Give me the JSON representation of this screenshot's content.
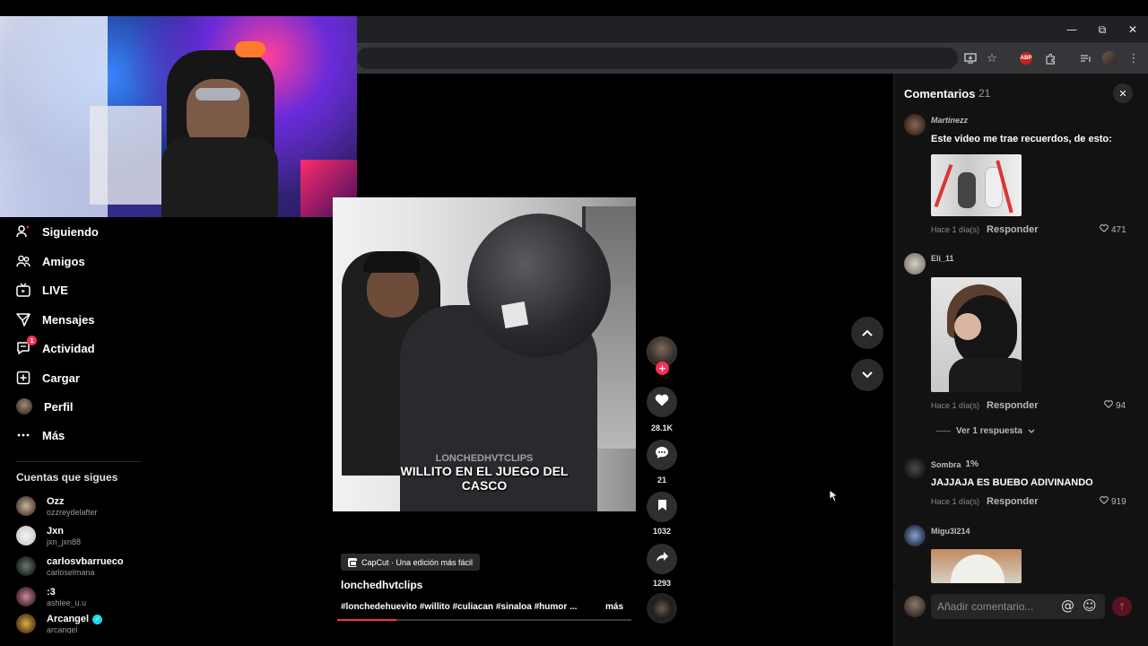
{
  "browser": {
    "window_controls": {
      "minimize": "—",
      "restore": "⧉",
      "close": "✕"
    },
    "toolbar_icons": [
      "install-app-icon",
      "bookmark-star-icon",
      "adblock-extension-icon",
      "extensions-puzzle-icon",
      "media-control-icon",
      "profile-avatar-icon",
      "menu-kebab-icon"
    ],
    "adblock_label": "ABP"
  },
  "sidebar": {
    "nav": [
      {
        "label": "Siguiendo",
        "icon": "following-icon"
      },
      {
        "label": "Amigos",
        "icon": "friends-icon"
      },
      {
        "label": "LIVE",
        "icon": "live-tv-icon"
      },
      {
        "label": "Mensajes",
        "icon": "messages-icon"
      },
      {
        "label": "Actividad",
        "icon": "activity-icon",
        "badge": "1"
      },
      {
        "label": "Cargar",
        "icon": "upload-icon"
      },
      {
        "label": "Perfil",
        "icon": "profile-icon"
      },
      {
        "label": "Más",
        "icon": "more-icon"
      }
    ],
    "following_title": "Cuentas que sigues",
    "accounts": [
      {
        "name": "Ozz",
        "handle": "ozzreydelafter",
        "verified": false
      },
      {
        "name": "Jxn",
        "handle": "jxn_jxn88",
        "verified": false
      },
      {
        "name": "carlosvbarrueco",
        "handle": "carloselmana",
        "verified": false
      },
      {
        "name": ":3",
        "handle": "ashlee_u.u",
        "verified": false
      },
      {
        "name": "Arcangel",
        "handle": "arcangel",
        "verified": true
      }
    ]
  },
  "video": {
    "watermark": "LONCHEDHVTCLIPS",
    "caption": "WILLITO EN EL JUEGO DEL CASCO",
    "capcut_label": "CapCut · Una edición más fácil",
    "author": "lonchedhvtclips",
    "hashtags": "#lonchedehuevito #willito #culiacan #sinaloa #humor ...",
    "more_label": "más",
    "progress": 0.2
  },
  "actions": {
    "likes": "28.1K",
    "comments": "21",
    "saves": "1032",
    "shares": "1293"
  },
  "comments_panel": {
    "title": "Comentarios",
    "count": "21",
    "comments": [
      {
        "user": "Martinezz",
        "text": "Este video me trae recuerdos, de esto:",
        "time": "Hace 1 día(s)",
        "reply": "Responder",
        "likes": "471"
      },
      {
        "user": "Eli_11",
        "text": "",
        "time": "Hace 1 día(s)",
        "reply": "Responder",
        "likes": "94",
        "view_replies": "Ver 1 respuesta"
      },
      {
        "user": "Sombra",
        "user_suffix": "1%",
        "text": "JAJJAJA ES BUEBO ADIVINANDO",
        "time": "Hace 1 día(s)",
        "reply": "Responder",
        "likes": "919"
      },
      {
        "user": "Migu3l214",
        "text": ""
      }
    ],
    "input_placeholder": "Añadir comentario..."
  },
  "colors": {
    "accent": "#fe2c55",
    "panel_bg": "#121212",
    "page_bg": "#000000"
  }
}
